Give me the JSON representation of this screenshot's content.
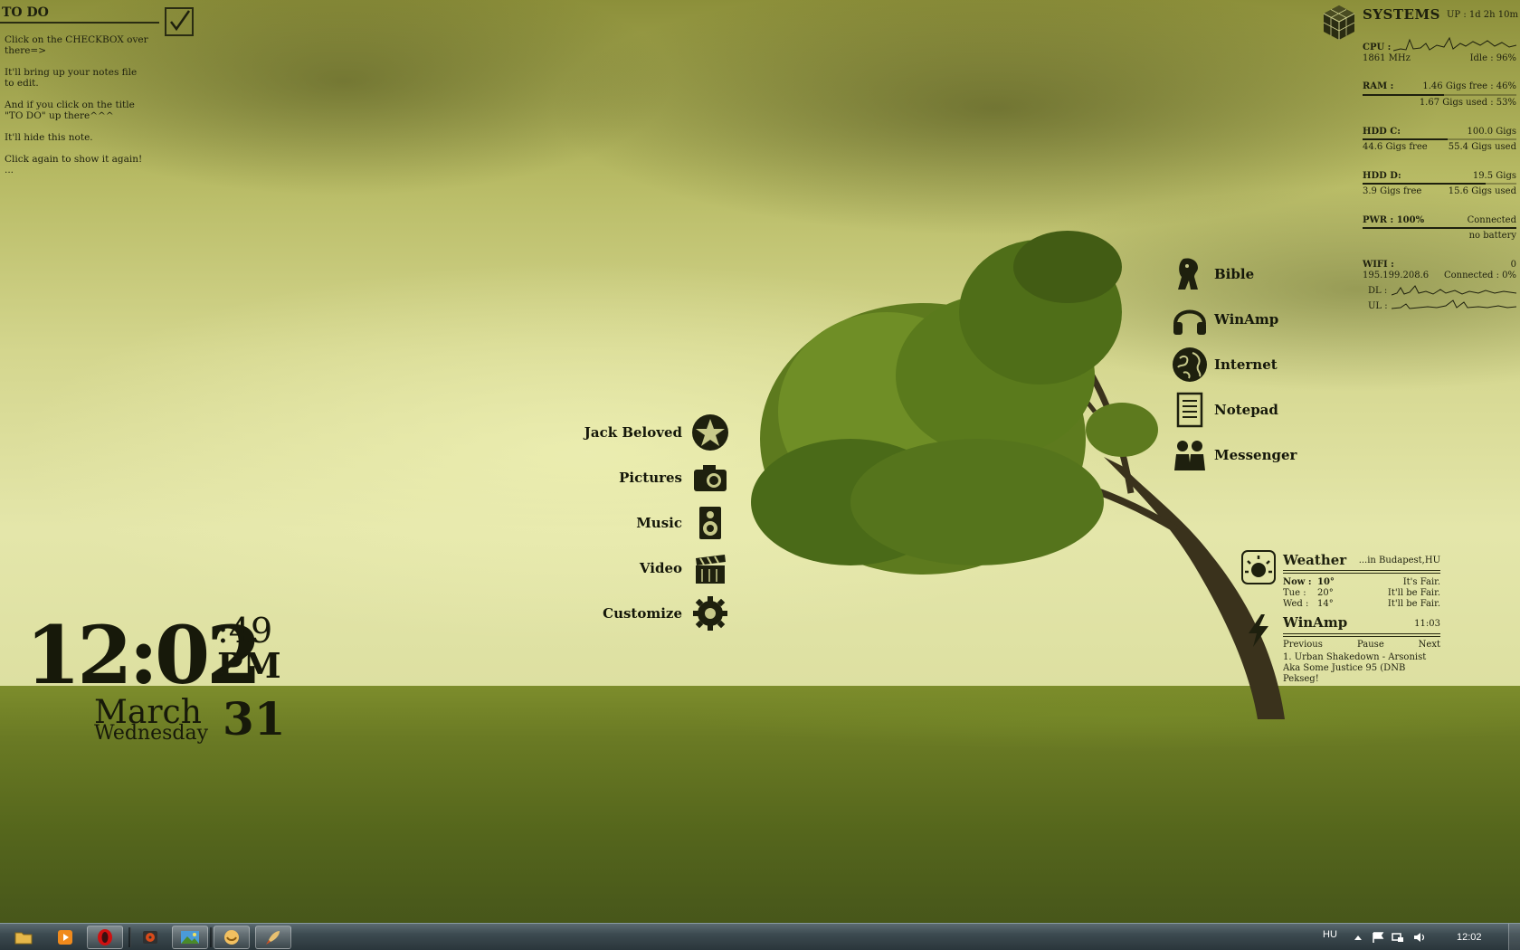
{
  "todo": {
    "title": "TO DO",
    "lines": [
      "Click on the CHECKBOX over there=>",
      "It'll bring up your notes file to edit.",
      "And if you click on the title \"TO DO\" up there^^^",
      "It'll hide this note.",
      "Click again to show it again!",
      "..."
    ]
  },
  "systems": {
    "title": "SYSTEMS",
    "uptime": "UP : 1d 2h 10m",
    "cpu": {
      "label": "CPU :",
      "freq": "1861 MHz",
      "idle": "Idle : 96%"
    },
    "ram": {
      "label": "RAM :",
      "free": "1.46 Gigs free : 46%",
      "used": "1.67 Gigs used : 53%",
      "used_fraction": 0.53
    },
    "hdd_c": {
      "label": "HDD C:",
      "total": "100.0 Gigs",
      "free": "44.6 Gigs free",
      "used": "55.4 Gigs used",
      "used_fraction": 0.554
    },
    "hdd_d": {
      "label": "HDD D:",
      "total": "19.5 Gigs",
      "free": "3.9 Gigs free",
      "used": "15.6 Gigs used",
      "used_fraction": 0.8
    },
    "pwr": {
      "label": "PWR : 100%",
      "status": "Connected",
      "battery": "no battery",
      "fraction": 1.0
    },
    "wifi": {
      "label": "WIFI :",
      "value": "0",
      "ip": "195.199.208.6",
      "status": "Connected : 0%",
      "dl": "DL :",
      "ul": "UL :"
    }
  },
  "launcher_left": [
    {
      "label": "Jack Beloved",
      "icon": "star-icon"
    },
    {
      "label": "Pictures",
      "icon": "camera-icon"
    },
    {
      "label": "Music",
      "icon": "speaker-icon"
    },
    {
      "label": "Video",
      "icon": "clapperboard-icon"
    },
    {
      "label": "Customize",
      "icon": "gear-icon"
    }
  ],
  "launcher_right": [
    {
      "label": "Bible",
      "icon": "lion-icon"
    },
    {
      "label": "WinAmp",
      "icon": "headphones-icon"
    },
    {
      "label": "Internet",
      "icon": "globe-icon"
    },
    {
      "label": "Notepad",
      "icon": "notepad-icon"
    },
    {
      "label": "Messenger",
      "icon": "people-icon"
    }
  ],
  "clock": {
    "time": "12:02",
    "seconds": ":49",
    "ampm": "PM",
    "month": "March",
    "day": "31",
    "weekday": "Wednesday"
  },
  "weather": {
    "title": "Weather",
    "location": "...in Budapest,HU",
    "rows": [
      {
        "day": "Now :",
        "temp": "10°",
        "cond": "It's Fair."
      },
      {
        "day": "Tue :",
        "temp": "20°",
        "cond": "It'll be Fair."
      },
      {
        "day": "Wed :",
        "temp": "14°",
        "cond": "It'll be Fair."
      }
    ]
  },
  "winamp": {
    "title": "WinAmp",
    "time": "11:03",
    "previous": "Previous",
    "pause": "Pause",
    "next": "Next",
    "track": "1. Urban Shakedown - Arsonist Aka Some Justice 95  (DNB Pekseg!"
  },
  "taskbar": {
    "apps": [
      {
        "name": "folder-icon",
        "color": "#e6b84a"
      },
      {
        "name": "media-player-icon",
        "color": "#f08a1c"
      },
      {
        "name": "opera-icon",
        "color": "#d01010"
      },
      {
        "name": "nero-icon",
        "color": "#d84a1a"
      },
      {
        "name": "photo-icon",
        "color": "#4a9ad8"
      },
      {
        "name": "app-icon",
        "color": "#f2c060"
      },
      {
        "name": "rocket-icon",
        "color": "#e8c070"
      }
    ],
    "language": "HU",
    "clock": "12:02"
  }
}
